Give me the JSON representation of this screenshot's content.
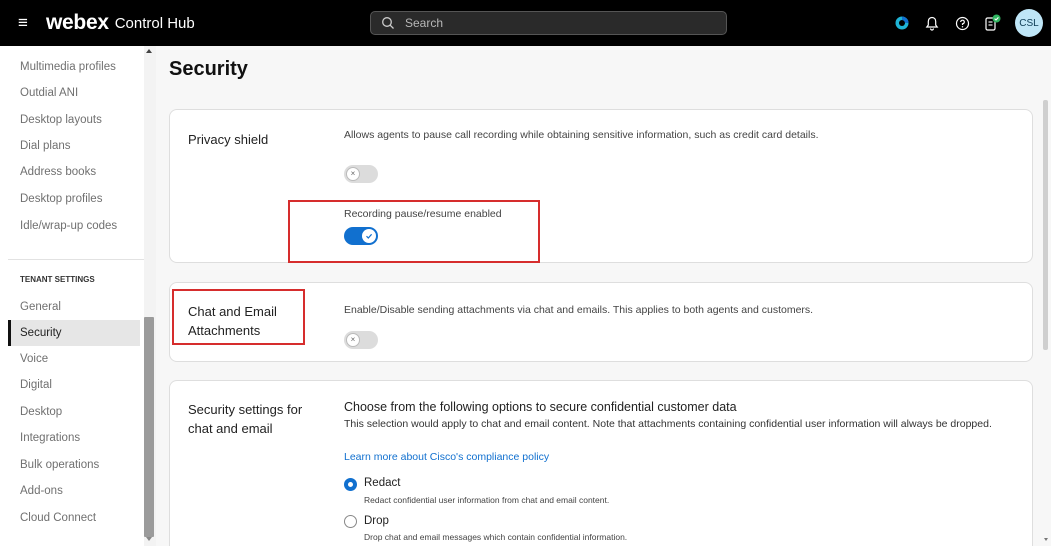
{
  "header": {
    "menu_icon": "menu-icon",
    "logo": "webex",
    "product": "Control Hub",
    "search_placeholder": "Search",
    "avatar_initials": "CSL"
  },
  "sidebar": {
    "items_top": [
      "Multimedia profiles",
      "Outdial ANI",
      "Desktop layouts",
      "Dial plans",
      "Address books",
      "Desktop profiles",
      "Idle/wrap-up codes"
    ],
    "section_title": "TENANT SETTINGS",
    "items_tenant": [
      "General",
      "Security",
      "Voice",
      "Digital",
      "Desktop",
      "Integrations",
      "Bulk operations",
      "Add-ons",
      "Cloud Connect"
    ],
    "active_item": "Security"
  },
  "page": {
    "title": "Security"
  },
  "privacy_shield": {
    "label": "Privacy shield",
    "description": "Allows agents to pause call recording while obtaining sensitive information, such as credit card details.",
    "toggle_enabled": false,
    "sub_setting_label": "Recording pause/resume enabled",
    "sub_toggle_enabled": true
  },
  "attachments": {
    "label": "Chat and Email Attachments",
    "description": "Enable/Disable sending attachments via chat and emails. This applies to both agents and customers.",
    "toggle_enabled": false
  },
  "security_settings": {
    "label": "Security settings for chat and email",
    "heading": "Choose from the following options to secure confidential customer data",
    "note": "This selection would apply to chat and email content. Note that attachments containing confidential user information will always be dropped.",
    "link": "Learn more about Cisco's compliance policy",
    "options": [
      {
        "label": "Redact",
        "description": "Redact confidential user information from chat and email content.",
        "selected": true
      },
      {
        "label": "Drop",
        "description": "Drop chat and email messages which contain confidential information.",
        "selected": false
      }
    ]
  },
  "colors": {
    "accent": "#1170cf",
    "highlight": "#d62d2d",
    "topbar": "#000000"
  }
}
